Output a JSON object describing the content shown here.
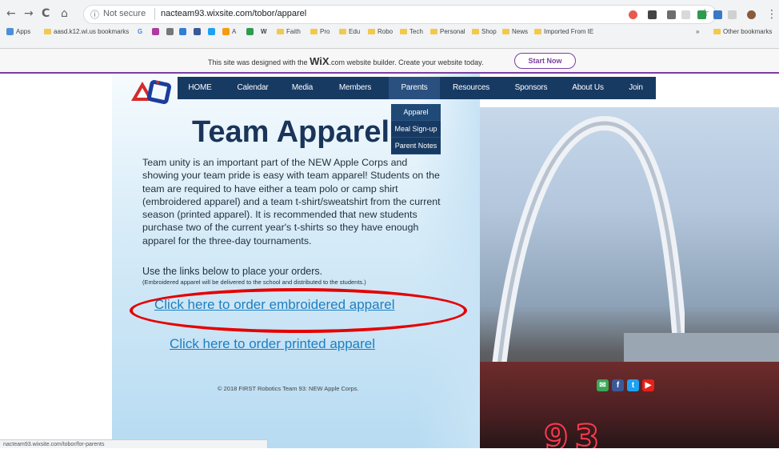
{
  "browser": {
    "nav_back": "←",
    "nav_forward": "→",
    "reload": "C",
    "home": "⌂",
    "security": "Not secure",
    "url": "nacteam93.wixsite.com/tobor/apparel",
    "star": "☆",
    "menu": "⋮"
  },
  "bookmarks": [
    {
      "label": "Apps"
    },
    {
      "label": "aasd.k12.wi.us bookmarks"
    },
    {
      "label": "G"
    },
    {
      "label": "A"
    },
    {
      "label": "W"
    },
    {
      "label": "Faith"
    },
    {
      "label": "Pro"
    },
    {
      "label": "Edu"
    },
    {
      "label": "Robo"
    },
    {
      "label": "Tech"
    },
    {
      "label": "Personal"
    },
    {
      "label": "Shop"
    },
    {
      "label": "News"
    },
    {
      "label": "Imported From IE"
    },
    {
      "label": "»"
    },
    {
      "label": "Other bookmarks"
    }
  ],
  "wix": {
    "text_before": "This site was designed with the ",
    "brand": "WiX",
    "text_after": ".com website builder. Create your website today.",
    "button": "Start Now"
  },
  "nav": {
    "items": [
      "HOME",
      "Calendar",
      "Media",
      "Members",
      "Parents",
      "Resources",
      "Sponsors",
      "About Us",
      "Join"
    ],
    "dropdown": [
      "Apparel",
      "Meal Sign-up",
      "Parent Notes"
    ]
  },
  "content": {
    "title": "Team Apparel",
    "paragraph": "Team unity is an important part of the NEW Apple Corps and showing your team pride is easy with team apparel!  Students on the team are required to have either a team polo or camp shirt (embroidered apparel) and a team t-shirt/sweatshirt from the current season (printed apparel).  It is recommended that new students purchase two of the current year's t-shirts so they have enough apparel for the three-day tournaments.",
    "use_links": "Use the links below to place your orders.",
    "note": "(Embroidered apparel will be delivered to the school and distributed to the students.)",
    "link_embroidered": "Click here to order embroidered apparel",
    "link_printed": "Click here to order printed apparel",
    "copyright": "© 2018 FIRST Robotics Team 93: NEW Apple Corps."
  },
  "photo": {
    "neon": "93"
  },
  "status": "nacteam93.wixsite.com/tobor/for-parents"
}
